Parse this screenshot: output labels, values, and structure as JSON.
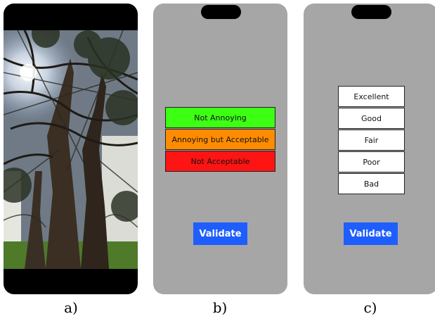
{
  "panels": {
    "a": {
      "caption": "a)"
    },
    "b": {
      "caption": "b)",
      "options": [
        {
          "label": "Not Annoying",
          "color": "#3dff14"
        },
        {
          "label": "Annoying but Acceptable",
          "color": "#ff8c00"
        },
        {
          "label": "Not Acceptable",
          "color": "#ff1414"
        }
      ],
      "validate_label": "Validate"
    },
    "c": {
      "caption": "c)",
      "options": [
        "Excellent",
        "Good",
        "Fair",
        "Poor",
        "Bad"
      ],
      "validate_label": "Validate"
    }
  },
  "colors": {
    "phone_background": "#a6a6a6",
    "validate_button": "#1e5eff",
    "notch": "#000000"
  }
}
